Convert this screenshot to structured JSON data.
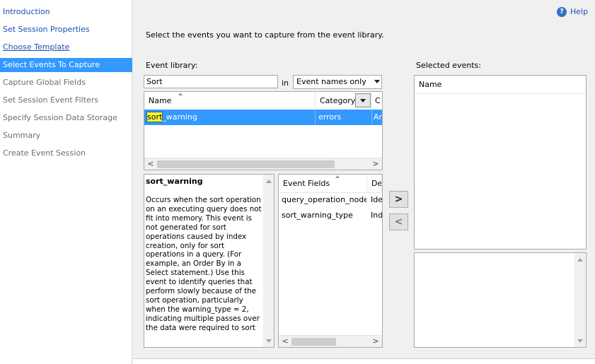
{
  "sidebar": {
    "items": [
      {
        "label": "Introduction"
      },
      {
        "label": "Set Session Properties"
      },
      {
        "label": "Choose Template"
      },
      {
        "label": "Select Events To Capture"
      },
      {
        "label": "Capture Global Fields"
      },
      {
        "label": "Set Session Event Filters"
      },
      {
        "label": "Specify Session Data Storage"
      },
      {
        "label": "Summary"
      },
      {
        "label": "Create Event Session"
      }
    ]
  },
  "header": {
    "help_label": "Help",
    "help_icon": "?",
    "instruction": "Select the events you want to capture from the event library."
  },
  "library": {
    "label": "Event library:",
    "search_value": "Sort",
    "in_label": "in",
    "search_scope": "Event names only",
    "columns": [
      "Name",
      "Category",
      "C"
    ],
    "rows": [
      {
        "name_match": "sort",
        "name_rest": "_warning",
        "category": "errors",
        "channel": "An"
      }
    ],
    "scroll_left": "<",
    "scroll_right": ">"
  },
  "description": {
    "title": "sort_warning",
    "body": "Occurs when the sort operation on an executing query does not fit into memory. This event is not generated for sort operations caused by index creation, only for sort operations in a query. (For example, an Order By in a Select statement.) Use this event to identify queries that perform slowly because of the sort operation, particularly when the warning_type = 2, indicating multiple passes over the data were required to sort"
  },
  "fields": {
    "columns": [
      "Event Fields",
      "De"
    ],
    "rows": [
      {
        "name": "query_operation_node_id",
        "desc": "Ide"
      },
      {
        "name": "sort_warning_type",
        "desc": "Ind"
      }
    ],
    "scroll_left": "<",
    "scroll_right": ">"
  },
  "buttons": {
    "add": ">",
    "remove": "<"
  },
  "selected": {
    "label": "Selected events:",
    "column": "Name"
  }
}
